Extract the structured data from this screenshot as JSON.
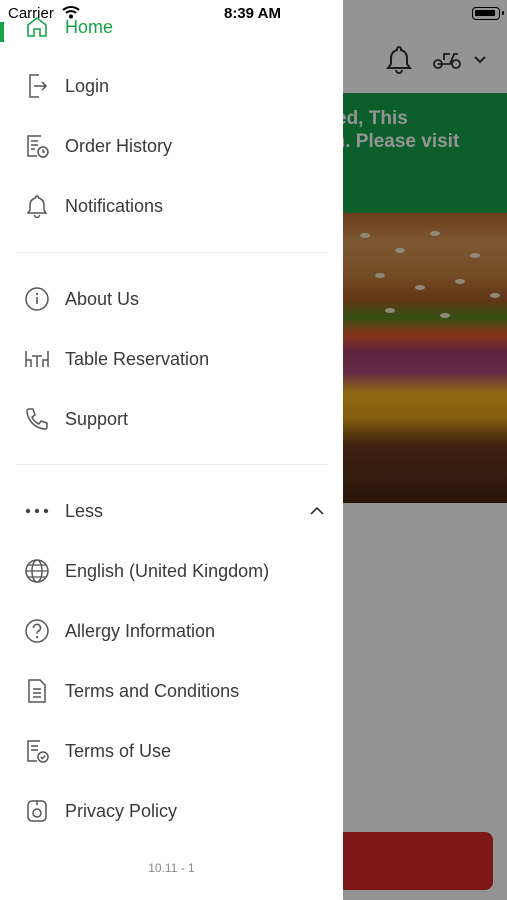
{
  "status_bar": {
    "carrier": "Carrier",
    "time": "8:39 AM"
  },
  "background": {
    "banner_lines": [
      "ed, This",
      "on. Please visit",
      "/"
    ]
  },
  "menu": {
    "home": "Home",
    "login": "Login",
    "order_history": "Order History",
    "notifications": "Notifications",
    "about_us": "About Us",
    "table_reservation": "Table Reservation",
    "support": "Support",
    "less": "Less",
    "language": "English (United Kingdom)",
    "allergy_information": "Allergy Information",
    "terms_and_conditions": "Terms and Conditions",
    "terms_of_use": "Terms of Use",
    "privacy_policy": "Privacy Policy"
  },
  "version": "10.11 - 1",
  "colors": {
    "accent": "#16a34a",
    "banner": "#16a34a",
    "cta": "#d92a2a"
  }
}
